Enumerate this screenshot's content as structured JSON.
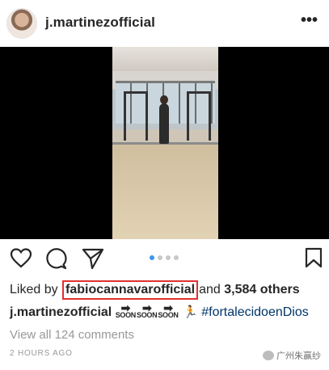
{
  "post": {
    "username": "j.martinezofficial",
    "more_label": "•••"
  },
  "carousel": {
    "active_index": 1,
    "total": 4
  },
  "likes": {
    "prefix": "Liked by",
    "tagged_user": "fabiocannavarofficial",
    "and_word": "and",
    "others": "3,584 others"
  },
  "caption": {
    "user": "j.martinezofficial",
    "soon_word": "SOON",
    "hashtag": "#fortalecidoenDios"
  },
  "comments_link": "View all 124 comments",
  "time_ago": "2 HOURS AGO",
  "watermark": "广州朱赢纱",
  "colors": {
    "text": "#262626",
    "muted": "#999999",
    "hashtag": "#003569",
    "active_dot": "#3897f0",
    "highlight_box": "#e03030"
  }
}
